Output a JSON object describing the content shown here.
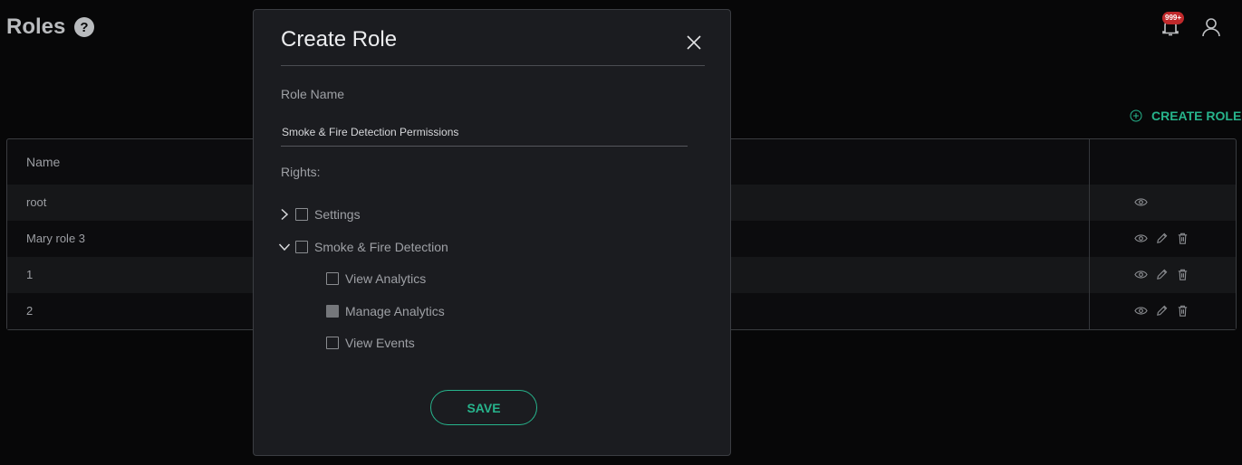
{
  "header": {
    "title": "Roles",
    "notification_badge": "999+"
  },
  "toolbar": {
    "create_role_label": "CREATE ROLE"
  },
  "table": {
    "columns": [
      "Name",
      ""
    ],
    "rows": [
      {
        "name": "root",
        "actions": [
          "view"
        ]
      },
      {
        "name": "Mary role 3",
        "actions": [
          "view",
          "edit",
          "delete"
        ]
      },
      {
        "name": "1",
        "actions": [
          "view",
          "edit",
          "delete"
        ]
      },
      {
        "name": "2",
        "actions": [
          "view",
          "edit",
          "delete"
        ]
      }
    ]
  },
  "modal": {
    "title": "Create Role",
    "role_name_label": "Role Name",
    "role_name_value": "Smoke & Fire Detection Permissions",
    "rights_label": "Rights:",
    "rights": [
      {
        "label": "Settings",
        "expanded": false,
        "state": "unchecked"
      },
      {
        "label": "Smoke & Fire Detection",
        "expanded": true,
        "state": "unchecked",
        "children": [
          {
            "label": "View Analytics",
            "state": "unchecked"
          },
          {
            "label": "Manage Analytics",
            "state": "indeterminate"
          },
          {
            "label": "View Events",
            "state": "unchecked"
          }
        ]
      }
    ],
    "save_label": "SAVE"
  },
  "colors": {
    "accent": "#27b48c",
    "badge": "#c0292b",
    "background": "#070708",
    "modal_bg": "#1b1c20"
  },
  "icons": [
    "help-icon",
    "bell-icon",
    "user-icon",
    "plus-circle-icon",
    "close-icon",
    "chevron-right-icon",
    "chevron-down-icon",
    "eye-icon",
    "pencil-icon",
    "trash-icon"
  ]
}
